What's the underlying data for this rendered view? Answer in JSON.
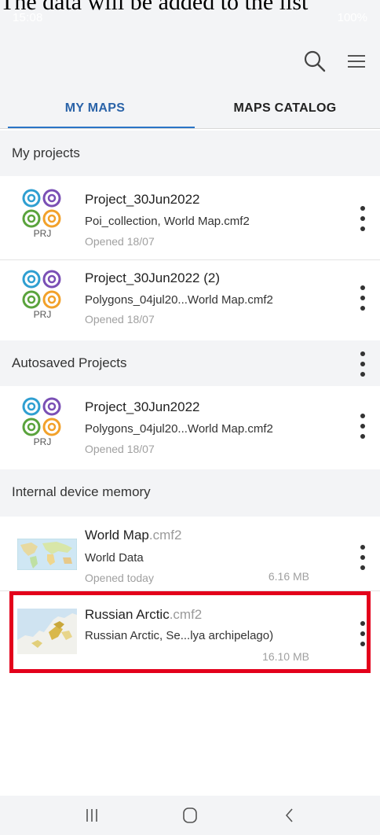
{
  "overlay_text": "The data will be added to the list",
  "status_bar": {
    "time": "15:08",
    "right_text": "100%"
  },
  "app_bar": {
    "search_icon": "search-icon",
    "menu_icon": "hamburger-icon"
  },
  "tabs": [
    {
      "label": "MY MAPS",
      "active": true
    },
    {
      "label": "MAPS CATALOG",
      "active": false
    }
  ],
  "sections": {
    "my_projects": {
      "title": "My projects",
      "items": [
        {
          "icon_label": "PRJ",
          "title": "Project_30Jun2022",
          "subtitle": "Poi_collection, World Map.cmf2",
          "meta": "Opened 18/07"
        },
        {
          "icon_label": "PRJ",
          "title": "Project_30Jun2022 (2)",
          "subtitle": "Polygons_04jul20...World Map.cmf2",
          "meta": "Opened 18/07"
        }
      ]
    },
    "autosaved": {
      "title": "Autosaved Projects",
      "items": [
        {
          "icon_label": "PRJ",
          "title": "Project_30Jun2022",
          "subtitle": "Polygons_04jul20...World Map.cmf2",
          "meta": "Opened 18/07"
        }
      ]
    },
    "internal": {
      "title": "Internal device memory",
      "items": [
        {
          "title": "World Map",
          "ext": ".cmf2",
          "subtitle": "World Data",
          "meta": "Opened today",
          "size": "6.16 MB"
        },
        {
          "title": "Russian Arctic",
          "ext": ".cmf2",
          "subtitle": "Russian Arctic, Se...lya archipelago)",
          "meta": "",
          "size": "16.10 MB"
        }
      ]
    }
  },
  "colors": {
    "accent": "#2a74c6",
    "highlight": "#e3001b",
    "icon_blue": "#2f9fd1",
    "icon_purple": "#7a4fb5",
    "icon_green": "#5aa33c",
    "icon_orange": "#f2a12a"
  },
  "nav_bar": {
    "recents_icon": "recents-icon",
    "home_icon": "home-icon",
    "back_icon": "back-icon"
  }
}
